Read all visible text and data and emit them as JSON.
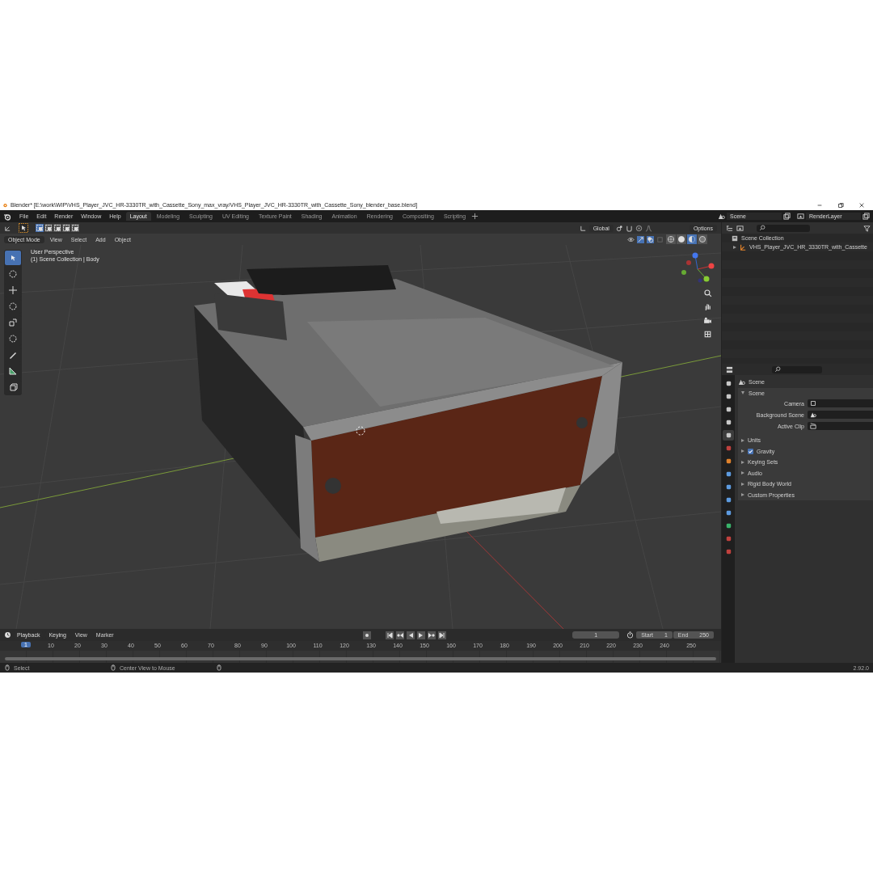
{
  "title_bar": {
    "title": "Blender* [E:\\work\\WIP\\VHS_Player_JVC_HR-3330TR_with_Cassette_Sony_max_vray/VHS_Player_JVC_HR-3330TR_with_Cassette_Sony_blender_base.blend]"
  },
  "menu": [
    "File",
    "Edit",
    "Render",
    "Window",
    "Help"
  ],
  "workspaces": [
    {
      "label": "Layout",
      "selected": true
    },
    {
      "label": "Modeling",
      "selected": false
    },
    {
      "label": "Sculpting",
      "selected": false
    },
    {
      "label": "UV Editing",
      "selected": false
    },
    {
      "label": "Texture Paint",
      "selected": false
    },
    {
      "label": "Shading",
      "selected": false
    },
    {
      "label": "Animation",
      "selected": false
    },
    {
      "label": "Rendering",
      "selected": false
    },
    {
      "label": "Compositing",
      "selected": false
    },
    {
      "label": "Scripting",
      "selected": false
    }
  ],
  "scene": "Scene",
  "view_layer": "RenderLayer",
  "viewport": {
    "orientation": "Global",
    "options": "Options",
    "mode": "Object Mode",
    "menus": [
      "View",
      "Select",
      "Add",
      "Object"
    ],
    "select_modes": [
      {
        "selected": true
      },
      {
        "selected": false
      },
      {
        "selected": false
      },
      {
        "selected": false
      },
      {
        "selected": false
      }
    ],
    "shading": [
      {
        "kind": "wireframe",
        "selected": false
      },
      {
        "kind": "solid",
        "selected": false
      },
      {
        "kind": "material",
        "selected": true
      },
      {
        "kind": "rendered",
        "selected": false
      }
    ],
    "overlay": [
      "User Perspective",
      "(1) Scene Collection | Body"
    ],
    "tools": [
      {
        "kind": "select",
        "selected": true
      },
      {
        "kind": "cursor",
        "selected": false
      },
      {
        "kind": "move",
        "selected": false
      },
      {
        "kind": "rotate",
        "selected": false
      },
      {
        "kind": "scale",
        "selected": false
      },
      {
        "kind": "transform",
        "selected": false
      },
      {
        "kind": "annotate",
        "selected": false
      },
      {
        "kind": "measure",
        "selected": false
      },
      {
        "kind": "add-cube",
        "selected": false
      }
    ]
  },
  "outliner": {
    "root": "Scene Collection",
    "children": [
      {
        "label": "VHS_Player_JVC_HR_3330TR_with_Cassette",
        "expanded": false
      }
    ]
  },
  "properties": {
    "tabs": [
      {
        "kind": "tool",
        "selected": false
      },
      {
        "kind": "render",
        "selected": false
      },
      {
        "kind": "output",
        "selected": false
      },
      {
        "kind": "view_layer",
        "selected": false
      },
      {
        "kind": "scene",
        "selected": true
      },
      {
        "kind": "world",
        "selected": false
      },
      {
        "kind": "object",
        "selected": false
      },
      {
        "kind": "modifier",
        "selected": false
      },
      {
        "kind": "particles",
        "selected": false
      },
      {
        "kind": "physics",
        "selected": false
      },
      {
        "kind": "constraints",
        "selected": false
      },
      {
        "kind": "data",
        "selected": false
      },
      {
        "kind": "material",
        "selected": false
      },
      {
        "kind": "texture",
        "selected": false
      }
    ],
    "header": "Scene",
    "panel": {
      "title": "Scene",
      "expanded": true,
      "fields": [
        {
          "label": "Camera",
          "kind": "camera"
        },
        {
          "label": "Background Scene",
          "kind": "scene"
        },
        {
          "label": "Active Clip",
          "kind": "clip"
        }
      ]
    },
    "subpanels": [
      {
        "label": "Units",
        "kind": "plain",
        "expanded": false
      },
      {
        "label": "Gravity",
        "kind": "checkbox",
        "checked": true,
        "expanded": false
      },
      {
        "label": "Keying Sets",
        "kind": "plain",
        "expanded": false
      },
      {
        "label": "Audio",
        "kind": "plain",
        "expanded": false
      },
      {
        "label": "Rigid Body World",
        "kind": "plain",
        "expanded": false
      },
      {
        "label": "Custom Properties",
        "kind": "plain",
        "expanded": false
      }
    ]
  },
  "timeline": {
    "menus": [
      "Playback",
      "Keying",
      "View",
      "Marker"
    ],
    "current_frame": "1",
    "start_label": "Start",
    "start": "1",
    "end_label": "End",
    "end": "250",
    "playhead": "1",
    "ticks": [
      "10",
      "20",
      "30",
      "40",
      "50",
      "60",
      "70",
      "80",
      "90",
      "100",
      "110",
      "120",
      "130",
      "140",
      "150",
      "160",
      "170",
      "180",
      "190",
      "200",
      "210",
      "220",
      "230",
      "240",
      "250"
    ]
  },
  "status_bar": {
    "hints": [
      "Select",
      "Center View to Mouse"
    ],
    "version": "2.92.0"
  }
}
